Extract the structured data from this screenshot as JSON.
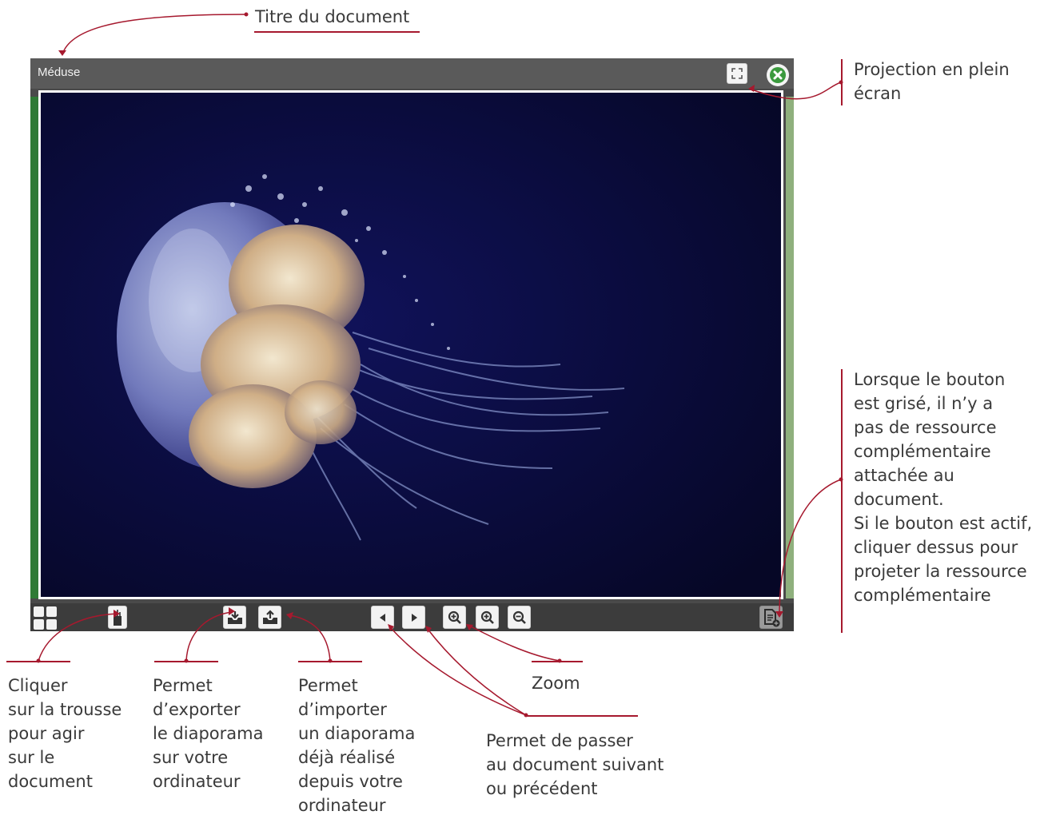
{
  "viewer": {
    "title": "Méduse",
    "image_subject": "jellyfish-photo"
  },
  "toolbar": {
    "icons": [
      "grid-icon",
      "pencil-case-icon",
      "export-icon",
      "import-icon",
      "previous-icon",
      "next-icon",
      "zoom-fit-icon",
      "zoom-in-icon",
      "zoom-out-icon",
      "resource-icon"
    ]
  },
  "annotations": {
    "title": "Titre du document",
    "fullscreen": "Projection en plein\nécran",
    "resource": "Lorsque le bouton\nest grisé, il n’y a\npas de ressource\ncomplémentaire\nattachée au\ndocument.\nSi le bouton est actif,\ncliquer dessus pour\nprojeter la ressource\ncomplémentaire",
    "trousse": "Cliquer\nsur la trousse\npour agir\nsur le\ndocument",
    "export": "Permet\nd’exporter\nle diaporama\nsur votre\nordinateur",
    "import": "Permet\nd’importer\nun diaporama\ndéjà réalisé\ndepuis votre\nordinateur",
    "navigation": "Permet de passer\nau document suivant\nou précédent",
    "zoom": "Zoom"
  },
  "colors": {
    "accent": "#a6192e",
    "titlebar": "#5a5a5a",
    "toolbar": "#3c3c3c",
    "photo_background": "#0a0b3a",
    "left_strip": "#2f7a35",
    "right_strip": "#8fb07d"
  }
}
